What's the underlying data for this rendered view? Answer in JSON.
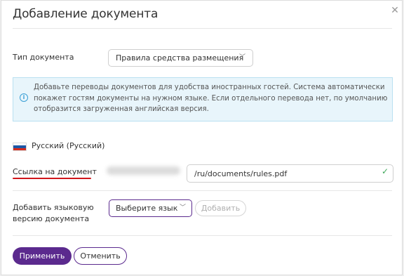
{
  "dialog": {
    "title": "Добавление документа",
    "close_icon": "close-icon"
  },
  "doc_type": {
    "label": "Тип документа",
    "selected": "Правила средства размещения"
  },
  "info": {
    "icon": "info-icon",
    "text": "Добавьте переводы документов для удобства иностранных гостей. Система автоматически покажет гостям документы на нужном языке. Если отдельного перевода нет, по умолчанию отобразится загруженная английская версия."
  },
  "language": {
    "flag_icon": "russia-flag-icon",
    "name": "Русский (Русский)"
  },
  "link": {
    "label": "Ссылка на документ",
    "value": "/ru/documents/rules.pdf",
    "valid_icon": "check-icon"
  },
  "add_language": {
    "label_line1": "Добавить языковую",
    "label_line2": "версию документа",
    "select_placeholder": "Выберите язык",
    "add_button": "Добавить"
  },
  "footer": {
    "apply_button": "Применить",
    "cancel_button": "Отменить"
  },
  "colors": {
    "accent": "#5b2a8e",
    "info_bg": "#e8f5fb",
    "info_border": "#b9e0f1",
    "underline": "#d0161b",
    "success": "#3fa85a"
  }
}
